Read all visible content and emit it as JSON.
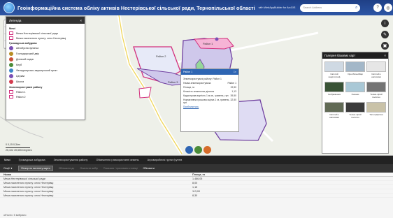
{
  "header": {
    "title": "Геоінформаційна система обліку активів Нестерівської сільської ради, Тернопільської області",
    "subtitle": "with WebAppBuilder for ArcGIS",
    "search_placeholder": "Search Address"
  },
  "map": {
    "scale": {
      "text": "0    0,15   0,3km",
      "coords": "25,102 49,555 Degrees"
    },
    "area_labels": [
      "Район 1",
      "Район 2",
      "Район 3",
      "Район 4"
    ]
  },
  "legend": {
    "title": "Легенда",
    "sections": [
      {
        "title": "Межі",
        "items": [
          {
            "label": "Межа Нестерівської сільської ради",
            "color": "#d3307d"
          },
          {
            "label": "Межа населеного пункту: село Нестерівці",
            "color": "#d3307d"
          }
        ]
      },
      {
        "title": "Громадська забудова",
        "items": [
          {
            "label": "Автобусна зупинка",
            "color": "#7a4fb4"
          },
          {
            "label": "Господарський двір",
            "color": "#b78d24"
          },
          {
            "label": "Дитячий садок",
            "color": "#c94f38"
          },
          {
            "label": "Клуб",
            "color": "#4b8c39"
          },
          {
            "label": "Фельдшерсько-акушерський пункт",
            "color": "#3b87c9"
          },
          {
            "label": "Церква",
            "color": "#7a4fb4"
          },
          {
            "label": "Школа",
            "color": "#d33b4e"
          }
        ]
      },
      {
        "title": "Землекористувачі району",
        "items": [
          {
            "label": "Район 1",
            "color": "#ffffff"
          },
          {
            "label": "Район 2",
            "color": "#ffffff"
          }
        ]
      }
    ]
  },
  "popup": {
    "title": "Район 1",
    "rows": [
      [
        "Землекористувачі району: Район 1",
        ""
      ],
      [
        "Назва землекористувача",
        "Район 1"
      ],
      [
        "Площа, га",
        "19,50"
      ],
      [
        "Кількість земельних ділянок",
        "1,13"
      ],
      [
        "Кадастрова вартість 1 м кв., гривень, грн",
        "39,50"
      ],
      [
        "Нормативна грошова оцінка 1 га, гривень, грн",
        "32,50"
      ]
    ],
    "link": "Приблизитись"
  },
  "gallery": {
    "title": "Галерея базових карт",
    "items": [
      {
        "label": "Світлий кардтограф",
        "color": "#cfd9e3"
      },
      {
        "label": "OpenStreetMap",
        "color": "#a3b7c8"
      },
      {
        "label": "Світлий з написами",
        "color": "#e6e6e6"
      },
      {
        "label": "Ізображення",
        "color": "#395336"
      },
      {
        "label": "Океани",
        "color": "#a9c8d6"
      },
      {
        "label": "Темно-сірий полотно",
        "color": "#747474"
      },
      {
        "label": "Світлий з написами",
        "color": "#616a55"
      },
      {
        "label": "Темно-сірий полотно",
        "color": "#3b3b3b"
      },
      {
        "label": "Топографічна",
        "color": "#c9c2a8"
      }
    ]
  },
  "bottom": {
    "tabs": [
      "Межі",
      "Громадська забудова",
      "Землекористування району",
      "Обмеження у використанні земель",
      "Агровиробничі групи ґрунтів"
    ],
    "toolbar": [
      "Опції ▼",
      "Фільтр по екстенту карти",
      "Збільшити до",
      "Очистити вибір",
      "Показати / приховати стовпці",
      "Обновити"
    ],
    "table": {
      "headers": [
        "Назва",
        "Площа, га"
      ],
      "rows": [
        [
          "Межа Нестерівської сільської ради",
          "1.486,05"
        ],
        [
          "Межа населеного пункту: село Нестерівці",
          "8,00"
        ],
        [
          "Межа населеного пункту: село Нестерівці",
          "1,15"
        ],
        [
          "Межа населеного пункту: село Нестерівці",
          "113,00"
        ],
        [
          "Межа населеного пункту: село Нестерівці",
          "8,30"
        ]
      ]
    },
    "footer": "об'єкти: 5 вибрано"
  },
  "colors": {
    "header": "#1f3f86",
    "boundary": "#d3307d",
    "popup": "#2e65b3"
  }
}
